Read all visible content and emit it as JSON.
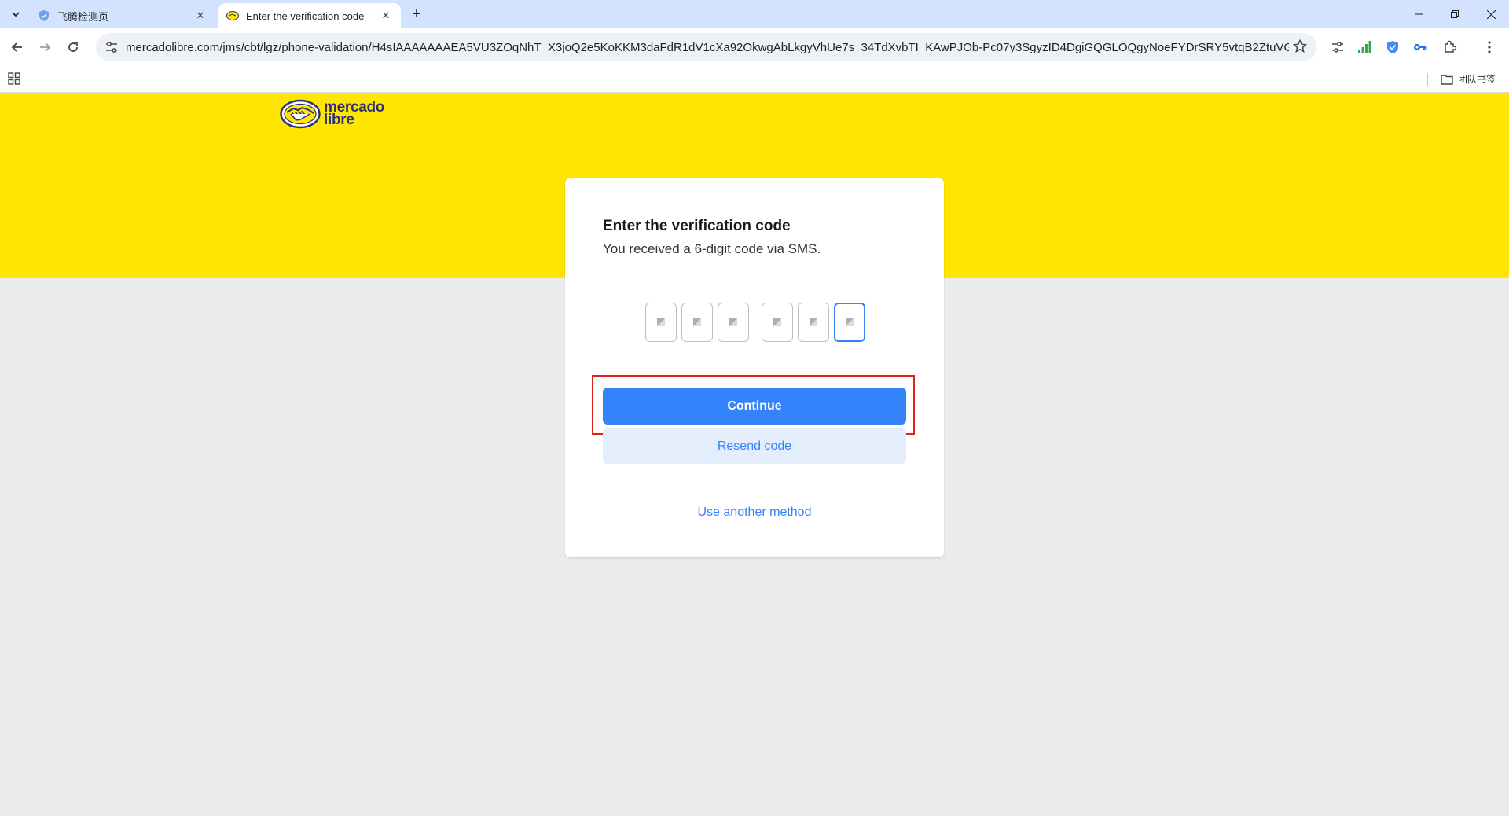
{
  "browser": {
    "tabs": [
      {
        "title": "飞腾检测页",
        "active": false
      },
      {
        "title": "Enter the verification code",
        "active": true
      }
    ],
    "url": "mercadolibre.com/jms/cbt/lgz/phone-validation/H4sIAAAAAAAEA5VU3ZOqNhT_X3joQ2e5KoKKM3daFdR1dV1cXa92OkwgAbLkgyVhUe7s_34TdXvbTI_KAwPJOb-Pc07y3SgyzID4DgiGQGLOQgyNoeFYDrSRY5vtqB2ZtuVGZ...",
    "bookmarks_folder": "团队书签",
    "accent": "#d3e3fd"
  },
  "header": {
    "logo_line1": "mercado",
    "logo_line2": "libre",
    "brand_color": "#ffe600",
    "logo_text_color": "#2d3277"
  },
  "card": {
    "title": "Enter the verification code",
    "subtitle": "You received a 6-digit code via SMS.",
    "code_digit_count": 6,
    "focused_digit_index": 5,
    "continue_label": "Continue",
    "resend_label": "Resend code",
    "another_method_label": "Use another method",
    "primary_color": "#3483fa",
    "highlight_color": "#e0201b"
  }
}
